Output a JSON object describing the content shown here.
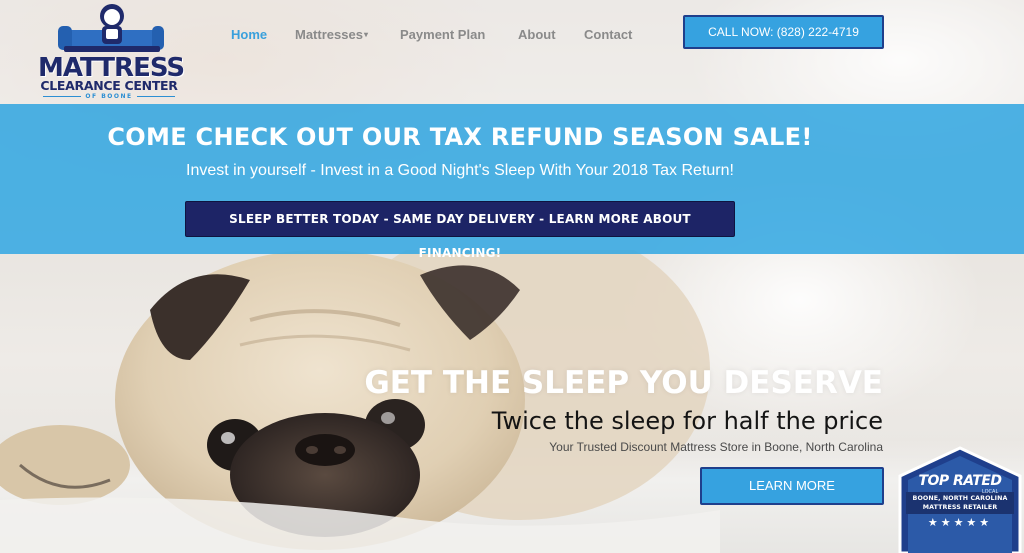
{
  "brand": {
    "line1": "MATTRESS",
    "line2": "CLEARANCE CENTER",
    "line3": "OF BOONE",
    "navy": "#1f2a6b",
    "accent_blue": "#36a2e0"
  },
  "nav": {
    "items": [
      {
        "label": "Home",
        "active": true
      },
      {
        "label": "Mattresses",
        "has_dropdown": true,
        "caret": "▾"
      },
      {
        "label": "Payment Plan"
      },
      {
        "label": "About"
      },
      {
        "label": "Contact"
      }
    ],
    "active_color": "#3aa0dc",
    "inactive_color": "#8a8a8a"
  },
  "call_button": {
    "label": "CALL NOW: (828) 222-4719"
  },
  "banner": {
    "title": "COME CHECK OUT OUR TAX REFUND SEASON SALE!",
    "subtitle": "Invest in yourself - Invest in a Good Night's Sleep With Your 2018 Tax Return!",
    "button_label": "SLEEP BETTER TODAY - SAME DAY DELIVERY - LEARN MORE ABOUT FINANCING!",
    "button_color": "#1d2466"
  },
  "hero": {
    "title": "GET THE SLEEP YOU DESERVE",
    "subtitle": "Twice the sleep for half the price",
    "tagline": "Your Trusted Discount Mattress Store in Boone, North Carolina",
    "button_label": "LEARN MORE",
    "image_icon": "pug-on-bed-photo"
  },
  "badge": {
    "title": "TOP RATED",
    "small": "LOCAL",
    "line1": "BOONE, NORTH CAROLINA",
    "line2": "MATTRESS RETAILER",
    "stars": "★★★★★"
  }
}
